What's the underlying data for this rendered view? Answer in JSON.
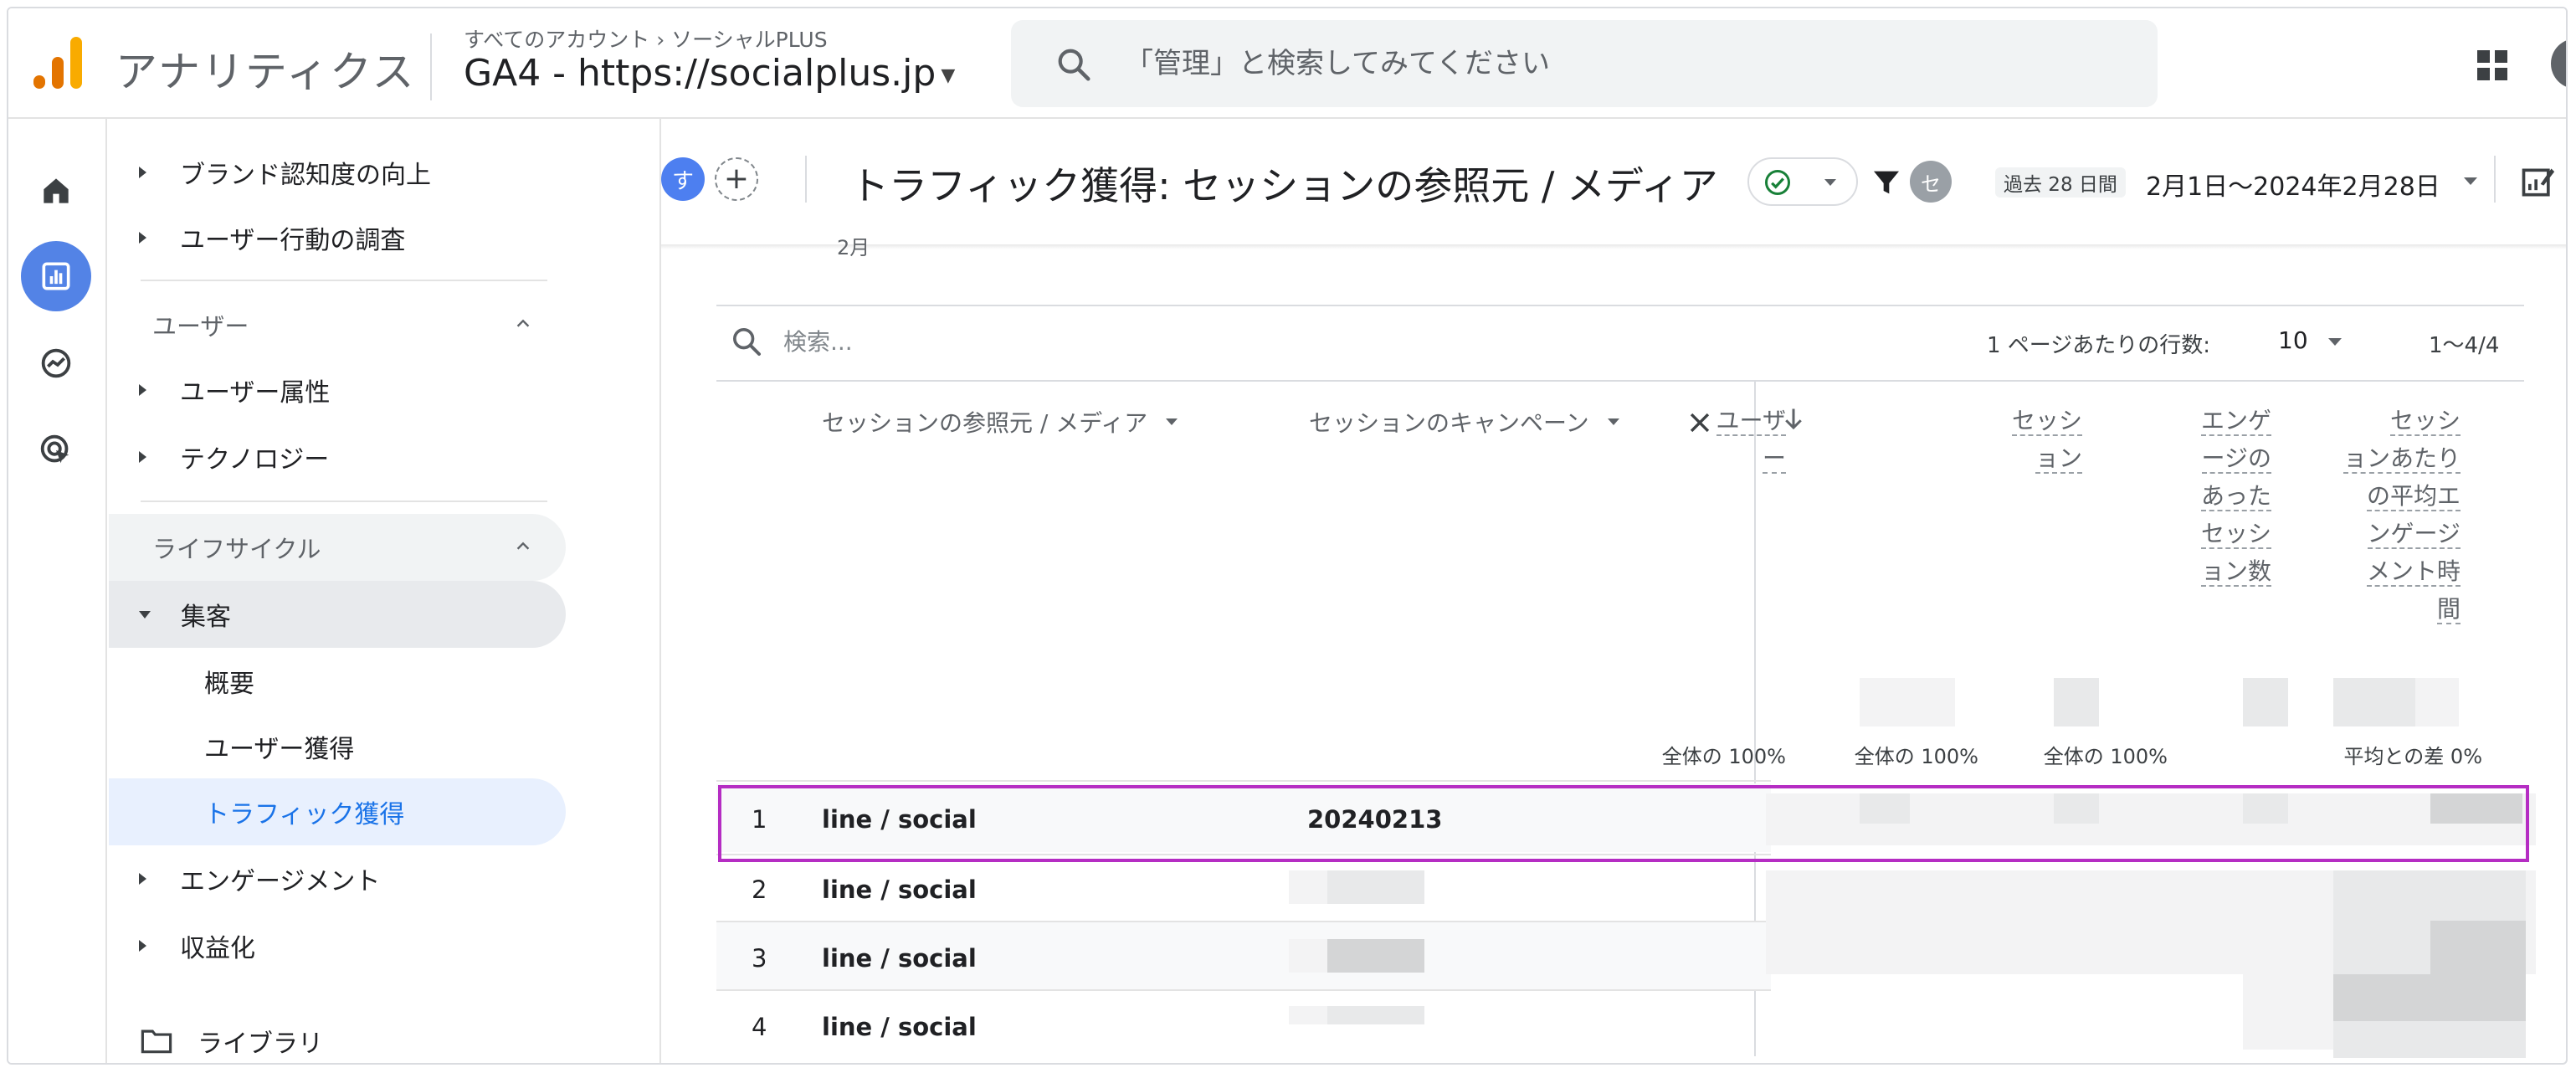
{
  "topbar": {
    "app_title": "アナリティクス",
    "breadcrumb_all": "すべてのアカウント",
    "breadcrumb_account": "ソーシャルPLUS",
    "property": "GA4 - https://socialplus.jp",
    "search_placeholder": "「管理」と検索してみてください"
  },
  "sidebar": {
    "items_top": [
      "ブランド認知度の向上",
      "ユーザー行動の調査"
    ],
    "user_section": {
      "label": "ユーザー",
      "items": [
        "ユーザー属性",
        "テクノロジー"
      ]
    },
    "lifecycle_section": {
      "label": "ライフサイクル"
    },
    "acquisition": {
      "label": "集客",
      "items": [
        "概要",
        "ユーザー獲得",
        "トラフィック獲得"
      ]
    },
    "items_bottom": [
      "エンゲージメント",
      "収益化"
    ],
    "library": "ライブラリ"
  },
  "report": {
    "user_chip": "す",
    "add_label": "+",
    "title": "トラフィック獲得: セッションの参照元 / メディア",
    "filter_chip": "セ",
    "date_badge": "過去 28 日間",
    "date_range": "2月1日～2024年2月28日",
    "cutoff_label": "2月"
  },
  "table": {
    "search_placeholder": "検索...",
    "rows_per_page_label": "1 ページあたりの行数:",
    "rows_per_page": "10",
    "pagination": "1～4/4",
    "dim1": "セッションの参照元 / メディア",
    "dim2": "セッションのキャンペーン",
    "metrics": [
      {
        "lines": [
          "ユーザ",
          "ー"
        ],
        "total": "全体の 100%"
      },
      {
        "lines": [
          "セッシ",
          "ョン"
        ],
        "total": "全体の 100%"
      },
      {
        "lines": [
          "エンゲ",
          "ージの",
          "あった",
          "セッシ",
          "ョン数"
        ],
        "total": "全体の 100%"
      },
      {
        "lines": [
          "セッシ",
          "ョンあたり",
          "の平均エ",
          "ンゲージ",
          "メント時",
          "間"
        ],
        "total": "平均との差 0%"
      }
    ],
    "rows": [
      {
        "idx": "1",
        "source": "line / social",
        "campaign": "20240213"
      },
      {
        "idx": "2",
        "source": "line / social",
        "campaign": ""
      },
      {
        "idx": "3",
        "source": "line / social",
        "campaign": ""
      },
      {
        "idx": "4",
        "source": "line / social",
        "campaign": ""
      }
    ]
  },
  "colors": {
    "accent": "#1a73e8",
    "highlight": "#b52dc3",
    "logo_orange": "#f9ab00",
    "logo_dark": "#e37400"
  }
}
